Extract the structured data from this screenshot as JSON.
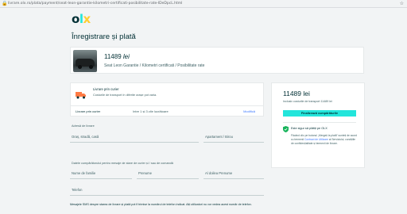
{
  "browser": {
    "url": "livrare.olx.ro/plata/payment/seat-leon-garantie-kilometri-certificati-posibilitate-rate-IDeDpcL.html"
  },
  "brand": {
    "logo_text": "olx",
    "colors": {
      "primary": "#002f34",
      "accent": "#23e5db",
      "link": "#3a77ff",
      "truck": "#ff7b45"
    }
  },
  "page": {
    "title": "Înregistrare și plată"
  },
  "ad": {
    "price": "11489",
    "currency": "lei",
    "title": "Seat Leon Garantie / Kilometri certificati / Posibilitate rate"
  },
  "delivery": {
    "method_label": "Livrare prin curier",
    "method_desc": "Costurile de transport în diferite orașe pot varia.",
    "row_label": "Livrare prin curier",
    "row_value": "între 1 și 3 zile lucrătoare",
    "row_link": "Modifică"
  },
  "address": {
    "section_label": "Adresă de livrare",
    "street_placeholder": "Oraș, stradă, casă",
    "apartment_placeholder": "Apartament / Birou"
  },
  "contact": {
    "section_label": "Datele cumpărătorului pentru mesaje de stare de curier și / sau de comandă",
    "last_name": "Nume de familie",
    "first_name": "Prenume",
    "middle_name": "Al doilea Prenume",
    "phone": "Telefon"
  },
  "sms_note": "Mesajele SMS despre starea de livrare și plată pot fi trimise la numărul de telefon indicat. Alți utilizatori nu vor vedea acest număr de telefon.",
  "summary": {
    "price": "11489 lei",
    "subtitle": "Inclusiv costurile de transport 11489 lei",
    "button": "Finalizează cumpărăturile",
    "safe_text": "Este sigur să plătiți pe OLX",
    "terms_prefix": "Făcând clic pe butonul „Mergeți la plată” sunteți de acord cu termenii ",
    "terms_link": "Contract de Utilizare",
    "terms_suffix": " al Serviciului, condițiile de confidențialitate și termenii de livrare."
  }
}
